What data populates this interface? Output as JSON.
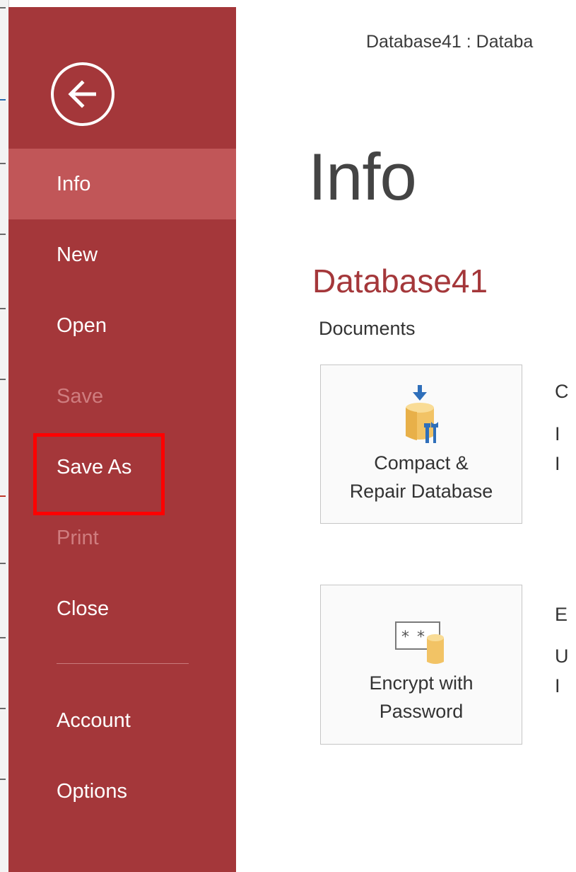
{
  "window": {
    "title": "Database41 : Databa"
  },
  "sidebar": {
    "back_icon": "back-arrow-icon",
    "items": [
      {
        "label": "Info",
        "state": "active"
      },
      {
        "label": "New",
        "state": "normal"
      },
      {
        "label": "Open",
        "state": "normal"
      },
      {
        "label": "Save",
        "state": "disabled"
      },
      {
        "label": "Save As",
        "state": "highlighted"
      },
      {
        "label": "Print",
        "state": "disabled"
      },
      {
        "label": "Close",
        "state": "normal"
      },
      {
        "label": "Account",
        "state": "normal"
      },
      {
        "label": "Options",
        "state": "normal"
      }
    ]
  },
  "main": {
    "page_title": "Info",
    "db_name": "Database41",
    "db_path": "Documents",
    "tiles": [
      {
        "label_line1": "Compact &",
        "label_line2": "Repair Database",
        "icon": "compact-repair-icon"
      },
      {
        "label_line1": "Encrypt with",
        "label_line2": "Password",
        "icon": "encrypt-password-icon"
      }
    ],
    "clipped_text": [
      "C",
      "I",
      "I",
      "E",
      "U",
      "I"
    ]
  },
  "colors": {
    "backstage_accent": "#a4373a",
    "active_item": "#c15658",
    "disabled_text": "#cf7d7f",
    "highlight_outline": "#ff0000"
  }
}
